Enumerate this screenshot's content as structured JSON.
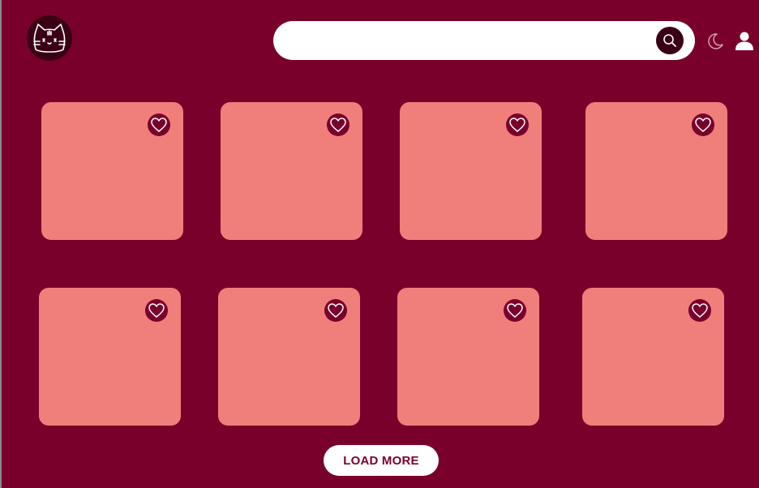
{
  "theme": {
    "background": "#7a002c",
    "card": "#f07f7b",
    "dark_accent": "#3a0013",
    "button_text": "#7a002c"
  },
  "header": {
    "logo_icon": "cat-face-icon",
    "search": {
      "placeholder": "",
      "value": "",
      "button_icon": "search-icon"
    },
    "theme_toggle_icon": "moon-icon",
    "profile_icon": "user-icon"
  },
  "gallery": {
    "cards": [
      {
        "favorite_icon": "heart-icon"
      },
      {
        "favorite_icon": "heart-icon"
      },
      {
        "favorite_icon": "heart-icon"
      },
      {
        "favorite_icon": "heart-icon"
      },
      {
        "favorite_icon": "heart-icon"
      },
      {
        "favorite_icon": "heart-icon"
      },
      {
        "favorite_icon": "heart-icon"
      },
      {
        "favorite_icon": "heart-icon"
      }
    ]
  },
  "load_more": {
    "label": "LOAD MORE"
  }
}
